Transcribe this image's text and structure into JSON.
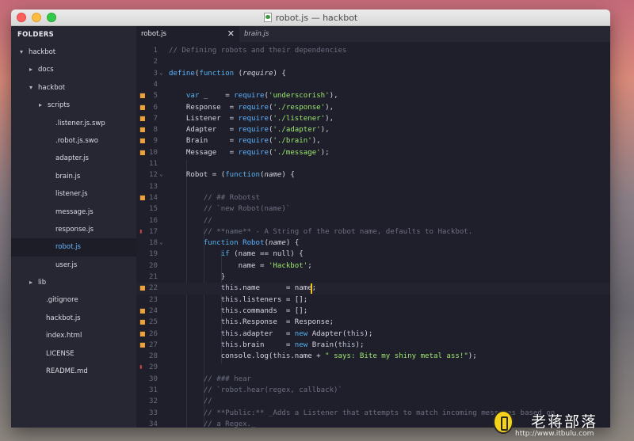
{
  "window": {
    "title": "robot.js — hackbot"
  },
  "sidebar": {
    "header": "FOLDERS",
    "items": [
      {
        "label": "hackbot",
        "depth": 0,
        "arrow": "down"
      },
      {
        "label": "docs",
        "depth": 1,
        "arrow": "right"
      },
      {
        "label": "hackbot",
        "depth": 1,
        "arrow": "down"
      },
      {
        "label": "scripts",
        "depth": 2,
        "arrow": "right"
      },
      {
        "label": ".listener.js.swp",
        "depth": 2,
        "arrow": ""
      },
      {
        "label": ".robot.js.swo",
        "depth": 2,
        "arrow": ""
      },
      {
        "label": "adapter.js",
        "depth": 2,
        "arrow": ""
      },
      {
        "label": "brain.js",
        "depth": 2,
        "arrow": ""
      },
      {
        "label": "listener.js",
        "depth": 2,
        "arrow": ""
      },
      {
        "label": "message.js",
        "depth": 2,
        "arrow": ""
      },
      {
        "label": "response.js",
        "depth": 2,
        "arrow": ""
      },
      {
        "label": "robot.js",
        "depth": 2,
        "arrow": "",
        "selected": true
      },
      {
        "label": "user.js",
        "depth": 2,
        "arrow": ""
      },
      {
        "label": "lib",
        "depth": 1,
        "arrow": "right"
      },
      {
        "label": ".gitignore",
        "depth": 1,
        "arrow": ""
      },
      {
        "label": "hackbot.js",
        "depth": 1,
        "arrow": ""
      },
      {
        "label": "index.html",
        "depth": 1,
        "arrow": ""
      },
      {
        "label": "LICENSE",
        "depth": 1,
        "arrow": ""
      },
      {
        "label": "README.md",
        "depth": 1,
        "arrow": ""
      }
    ]
  },
  "tabs": [
    {
      "label": "robot.js",
      "active": true,
      "close": "✕"
    },
    {
      "label": "brain.js",
      "active": false
    }
  ],
  "editor": {
    "current_line": 22,
    "lines": [
      {
        "n": 1,
        "tokens": [
          [
            "comment",
            "// Defining robots and their dependencies"
          ]
        ]
      },
      {
        "n": 2,
        "tokens": []
      },
      {
        "n": 3,
        "fold": true,
        "tokens": [
          [
            "function",
            "define"
          ],
          [
            "plain",
            "("
          ],
          [
            "keyword",
            "function"
          ],
          [
            "plain",
            " ("
          ],
          [
            "param",
            "require"
          ],
          [
            "plain",
            ") {"
          ]
        ]
      },
      {
        "n": 4,
        "tokens": []
      },
      {
        "n": 5,
        "mark": "mod",
        "tokens": [
          [
            "plain",
            "    "
          ],
          [
            "keyword",
            "var"
          ],
          [
            "plain",
            " _    = "
          ],
          [
            "function",
            "require"
          ],
          [
            "plain",
            "("
          ],
          [
            "string",
            "'underscorish'"
          ],
          [
            "plain",
            "),"
          ]
        ]
      },
      {
        "n": 6,
        "mark": "mod",
        "tokens": [
          [
            "plain",
            "    Response  = "
          ],
          [
            "function",
            "require"
          ],
          [
            "plain",
            "("
          ],
          [
            "string",
            "'./response'"
          ],
          [
            "plain",
            "),"
          ]
        ]
      },
      {
        "n": 7,
        "mark": "mod",
        "tokens": [
          [
            "plain",
            "    Listener  = "
          ],
          [
            "function",
            "require"
          ],
          [
            "plain",
            "("
          ],
          [
            "string",
            "'./listener'"
          ],
          [
            "plain",
            "),"
          ]
        ]
      },
      {
        "n": 8,
        "mark": "mod",
        "tokens": [
          [
            "plain",
            "    Adapter   = "
          ],
          [
            "function",
            "require"
          ],
          [
            "plain",
            "("
          ],
          [
            "string",
            "'./adapter'"
          ],
          [
            "plain",
            "),"
          ]
        ]
      },
      {
        "n": 9,
        "mark": "mod",
        "tokens": [
          [
            "plain",
            "    Brain     = "
          ],
          [
            "function",
            "require"
          ],
          [
            "plain",
            "("
          ],
          [
            "string",
            "'./brain'"
          ],
          [
            "plain",
            "),"
          ]
        ]
      },
      {
        "n": 10,
        "mark": "mod",
        "tokens": [
          [
            "plain",
            "    Message   = "
          ],
          [
            "function",
            "require"
          ],
          [
            "plain",
            "("
          ],
          [
            "string",
            "'./message'"
          ],
          [
            "plain",
            ");"
          ]
        ]
      },
      {
        "n": 11,
        "tokens": []
      },
      {
        "n": 12,
        "fold": true,
        "tokens": [
          [
            "plain",
            "    Robot = ("
          ],
          [
            "keyword",
            "function"
          ],
          [
            "plain",
            "("
          ],
          [
            "param",
            "name"
          ],
          [
            "plain",
            ") {"
          ]
        ]
      },
      {
        "n": 13,
        "tokens": []
      },
      {
        "n": 14,
        "mark": "mod",
        "tokens": [
          [
            "plain",
            "        "
          ],
          [
            "comment",
            "// ## Robotst"
          ]
        ]
      },
      {
        "n": 15,
        "tokens": [
          [
            "plain",
            "        "
          ],
          [
            "comment",
            "// `new Robot(name)`"
          ]
        ]
      },
      {
        "n": 16,
        "tokens": [
          [
            "plain",
            "        "
          ],
          [
            "comment",
            "//"
          ]
        ]
      },
      {
        "n": 17,
        "mark": "del",
        "tokens": [
          [
            "plain",
            "        "
          ],
          [
            "comment",
            "// **name** - A String of the robot name, defaults to Hackbot."
          ]
        ]
      },
      {
        "n": 18,
        "fold": true,
        "tokens": [
          [
            "plain",
            "        "
          ],
          [
            "keyword",
            "function"
          ],
          [
            "plain",
            " "
          ],
          [
            "function",
            "Robot"
          ],
          [
            "plain",
            "("
          ],
          [
            "param",
            "name"
          ],
          [
            "plain",
            ") {"
          ]
        ]
      },
      {
        "n": 19,
        "tokens": [
          [
            "plain",
            "            "
          ],
          [
            "keyword",
            "if"
          ],
          [
            "plain",
            " (name == null) {"
          ]
        ]
      },
      {
        "n": 20,
        "tokens": [
          [
            "plain",
            "                name = "
          ],
          [
            "string",
            "'Hackbot'"
          ],
          [
            "plain",
            ";"
          ]
        ]
      },
      {
        "n": 21,
        "tokens": [
          [
            "plain",
            "            }"
          ]
        ]
      },
      {
        "n": 22,
        "mark": "mod",
        "tokens": [
          [
            "plain",
            "            "
          ],
          [
            "this",
            "this"
          ],
          [
            "plain",
            ".name      = name;"
          ]
        ]
      },
      {
        "n": 23,
        "tokens": [
          [
            "plain",
            "            "
          ],
          [
            "this",
            "this"
          ],
          [
            "plain",
            ".listeners = [];"
          ]
        ]
      },
      {
        "n": 24,
        "mark": "mod",
        "tokens": [
          [
            "plain",
            "            "
          ],
          [
            "this",
            "this"
          ],
          [
            "plain",
            ".commands  = [];"
          ]
        ]
      },
      {
        "n": 25,
        "mark": "mod",
        "tokens": [
          [
            "plain",
            "            "
          ],
          [
            "this",
            "this"
          ],
          [
            "plain",
            ".Response  = Response;"
          ]
        ]
      },
      {
        "n": 26,
        "mark": "mod",
        "tokens": [
          [
            "plain",
            "            "
          ],
          [
            "this",
            "this"
          ],
          [
            "plain",
            ".adapter   = "
          ],
          [
            "keyword",
            "new"
          ],
          [
            "plain",
            " Adapter("
          ],
          [
            "this",
            "this"
          ],
          [
            "plain",
            ");"
          ]
        ]
      },
      {
        "n": 27,
        "mark": "mod",
        "tokens": [
          [
            "plain",
            "            "
          ],
          [
            "this",
            "this"
          ],
          [
            "plain",
            ".brain     = "
          ],
          [
            "keyword",
            "new"
          ],
          [
            "plain",
            " Brain("
          ],
          [
            "this",
            "this"
          ],
          [
            "plain",
            ");"
          ]
        ]
      },
      {
        "n": 28,
        "tokens": [
          [
            "plain",
            "            console.log("
          ],
          [
            "this",
            "this"
          ],
          [
            "plain",
            ".name + "
          ],
          [
            "string",
            "\" says: Bite my shiny metal ass!\""
          ],
          [
            "plain",
            ");"
          ]
        ]
      },
      {
        "n": 29,
        "mark": "del",
        "tokens": []
      },
      {
        "n": 30,
        "tokens": [
          [
            "plain",
            "        "
          ],
          [
            "comment",
            "// ### hear"
          ]
        ]
      },
      {
        "n": 31,
        "tokens": [
          [
            "plain",
            "        "
          ],
          [
            "comment",
            "// `robot.hear(regex, callback)`"
          ]
        ]
      },
      {
        "n": 32,
        "tokens": [
          [
            "plain",
            "        "
          ],
          [
            "comment",
            "//"
          ]
        ]
      },
      {
        "n": 33,
        "tokens": [
          [
            "plain",
            "        "
          ],
          [
            "comment",
            "// **Public:** _Adds a Listener that attempts to match incoming messages based on"
          ]
        ]
      },
      {
        "n": 34,
        "tokens": [
          [
            "plain",
            "        "
          ],
          [
            "comment",
            "// a Regex._"
          ]
        ]
      }
    ]
  },
  "watermark": {
    "text": "老蒋部落",
    "url": "http://www.itbulu.com"
  }
}
